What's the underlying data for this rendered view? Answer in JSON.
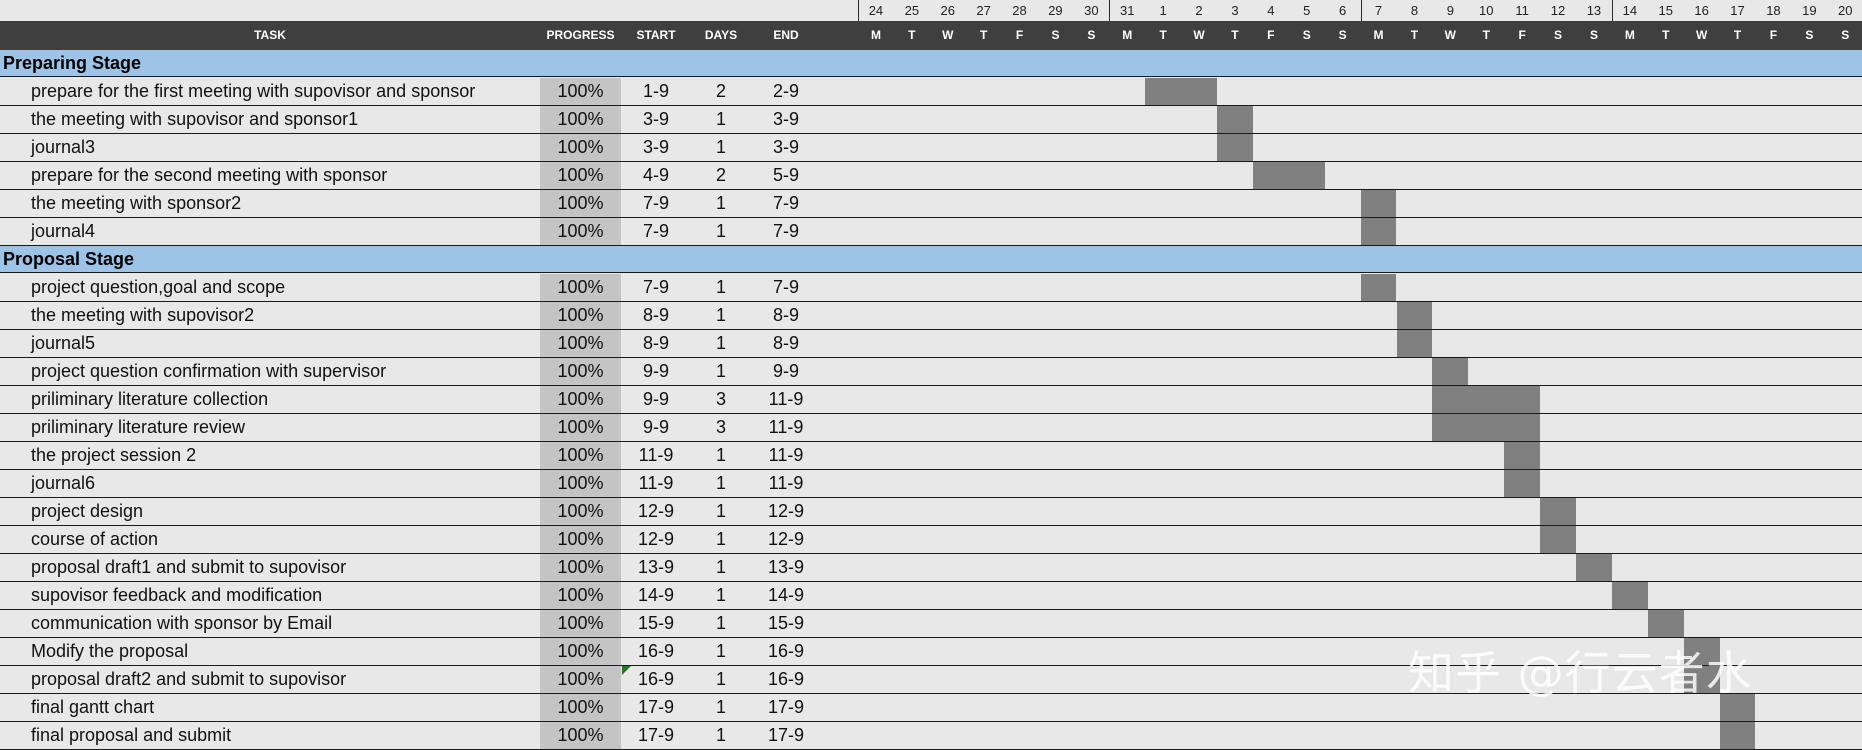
{
  "chart_data": {
    "type": "gantt",
    "columns": {
      "task": "TASK",
      "progress": "PROGRESS",
      "start": "START",
      "days": "DAYS",
      "end": "END"
    },
    "timeline": {
      "day_numbers": [
        "24",
        "25",
        "26",
        "27",
        "28",
        "29",
        "30",
        "31",
        "1",
        "2",
        "3",
        "4",
        "5",
        "6",
        "7",
        "8",
        "9",
        "10",
        "11",
        "12",
        "13",
        "14",
        "15",
        "16",
        "17",
        "18",
        "19",
        "20"
      ],
      "weekdays": [
        "M",
        "T",
        "W",
        "T",
        "F",
        "S",
        "S",
        "M",
        "T",
        "W",
        "T",
        "F",
        "S",
        "S",
        "M",
        "T",
        "W",
        "T",
        "F",
        "S",
        "S",
        "M",
        "T",
        "W",
        "T",
        "F",
        "S",
        "S"
      ]
    },
    "stages": [
      {
        "name": "Preparing Stage",
        "tasks": [
          {
            "task": "prepare for the first meeting with supovisor and sponsor",
            "progress": "100%",
            "start": "1-9",
            "days": 2,
            "end": "2-9"
          },
          {
            "task": "the meeting with supovisor and sponsor1",
            "progress": "100%",
            "start": "3-9",
            "days": 1,
            "end": "3-9"
          },
          {
            "task": "journal3",
            "progress": "100%",
            "start": "3-9",
            "days": 1,
            "end": "3-9"
          },
          {
            "task": "prepare for the second meeting with sponsor",
            "progress": "100%",
            "start": "4-9",
            "days": 2,
            "end": "5-9"
          },
          {
            "task": "the meeting with sponsor2",
            "progress": "100%",
            "start": "7-9",
            "days": 1,
            "end": "7-9"
          },
          {
            "task": "journal4",
            "progress": "100%",
            "start": "7-9",
            "days": 1,
            "end": "7-9"
          }
        ]
      },
      {
        "name": "Proposal Stage",
        "tasks": [
          {
            "task": "project question,goal and scope",
            "progress": "100%",
            "start": "7-9",
            "days": 1,
            "end": "7-9"
          },
          {
            "task": "the meeting with supovisor2",
            "progress": "100%",
            "start": "8-9",
            "days": 1,
            "end": "8-9"
          },
          {
            "task": "journal5",
            "progress": "100%",
            "start": "8-9",
            "days": 1,
            "end": "8-9"
          },
          {
            "task": "project question confirmation with supervisor",
            "progress": "100%",
            "start": "9-9",
            "days": 1,
            "end": "9-9"
          },
          {
            "task": "priliminary literature collection",
            "progress": "100%",
            "start": "9-9",
            "days": 3,
            "end": "11-9"
          },
          {
            "task": "priliminary literature review",
            "progress": "100%",
            "start": "9-9",
            "days": 3,
            "end": "11-9"
          },
          {
            "task": "the project session 2",
            "progress": "100%",
            "start": "11-9",
            "days": 1,
            "end": "11-9"
          },
          {
            "task": "journal6",
            "progress": "100%",
            "start": "11-9",
            "days": 1,
            "end": "11-9"
          },
          {
            "task": "project design",
            "progress": "100%",
            "start": "12-9",
            "days": 1,
            "end": "12-9"
          },
          {
            "task": "course of action",
            "progress": "100%",
            "start": "12-9",
            "days": 1,
            "end": "12-9"
          },
          {
            "task": "proposal draft1 and submit to supovisor",
            "progress": "100%",
            "start": "13-9",
            "days": 1,
            "end": "13-9"
          },
          {
            "task": "supovisor feedback and modification",
            "progress": "100%",
            "start": "14-9",
            "days": 1,
            "end": "14-9"
          },
          {
            "task": "communication with sponsor by Email",
            "progress": "100%",
            "start": "15-9",
            "days": 1,
            "end": "15-9"
          },
          {
            "task": "Modify the proposal",
            "progress": "100%",
            "start": "16-9",
            "days": 1,
            "end": "16-9"
          },
          {
            "task": "proposal draft2 and submit to supovisor",
            "progress": "100%",
            "start": "16-9",
            "days": 1,
            "end": "16-9"
          },
          {
            "task": "final gantt chart",
            "progress": "100%",
            "start": "17-9",
            "days": 1,
            "end": "17-9"
          },
          {
            "task": "final proposal and submit",
            "progress": "100%",
            "start": "17-9",
            "days": 1,
            "end": "17-9"
          }
        ]
      }
    ],
    "colors": {
      "header": "#3f3f3f",
      "stage": "#9dc3e6",
      "bar": "#808080",
      "progress_cell": "#c4c4c4",
      "background": "#e8e8e8"
    }
  },
  "watermark": "知乎 @行云者水"
}
